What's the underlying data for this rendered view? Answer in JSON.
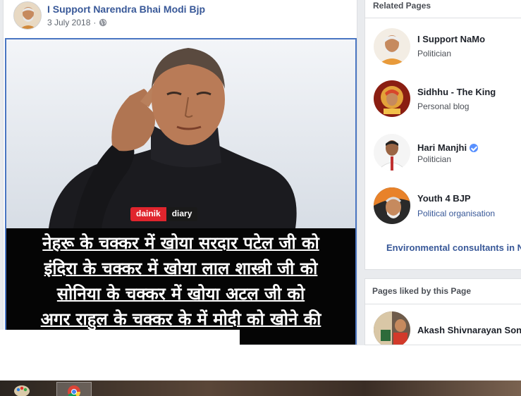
{
  "post": {
    "page_name": "I Support Narendra Bhai Modi Bjp",
    "date": "3 July 2018",
    "separator": "·",
    "privacy_icon": "globe-icon",
    "image": {
      "watermark_left": "dainik",
      "watermark_right": "diary",
      "caption_lines": [
        "नेहरू के चक्कर में खोया सरदार पटेल जी को",
        "इंदिरा के चक्कर में खोया लाल शास्त्री जी को",
        "सोनिया के चक्कर में खोया अटल जी को",
        "अगर राहुल के चक्कर के में मोदी को खोने की"
      ]
    }
  },
  "related_pages": {
    "title": "Related Pages",
    "items": [
      {
        "name": "I Support NaMo",
        "category": "Politician",
        "verified": false
      },
      {
        "name": "Sidhhu - The King",
        "category": "Personal blog",
        "verified": false
      },
      {
        "name": "Hari Manjhi",
        "category": "Politician",
        "verified": true
      },
      {
        "name": "Youth 4 BJP",
        "category": "Political organisation",
        "verified": false
      }
    ],
    "more_link": "Environmental consultants in N"
  },
  "pages_liked": {
    "title": "Pages liked by this Page",
    "items": [
      {
        "name": "Akash Shivnarayan Son"
      }
    ]
  },
  "colors": {
    "link": "#385898",
    "image_border": "#4a76c2",
    "verified": "#5890ff"
  }
}
